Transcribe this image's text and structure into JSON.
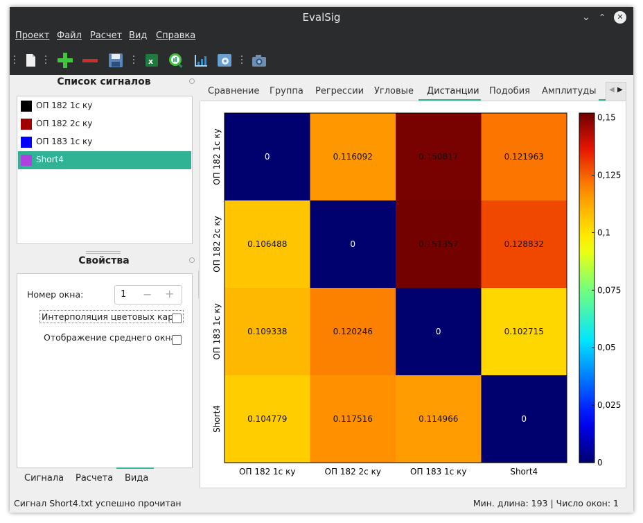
{
  "window": {
    "title": "EvalSig"
  },
  "menu": [
    "Проект",
    "Файл",
    "Расчет",
    "Вид",
    "Справка"
  ],
  "toolbar_icons": [
    "new-document-icon",
    "add-icon",
    "remove-icon",
    "save-icon",
    "excel-icon",
    "chart-search-icon",
    "bar-chart-icon",
    "settings-icon",
    "camera-icon"
  ],
  "signal_panel": {
    "title": "Список сигналов",
    "items": [
      {
        "label": "ОП 182 1с ку",
        "color": "#000000"
      },
      {
        "label": "ОП 182 2с ку",
        "color": "#a00000"
      },
      {
        "label": "ОП 183 1с ку",
        "color": "#0000ff"
      },
      {
        "label": "Short4",
        "color": "#b040e0"
      }
    ],
    "selected": "Short4"
  },
  "properties_panel": {
    "title": "Свойства",
    "window_number_label": "Номер окна:",
    "window_number_value": "1",
    "interp_label": "Интерполяция цветовых карт:",
    "mean_label": "Отображение среднего окна:"
  },
  "bottom_tabs": [
    "Сигнала",
    "Расчета",
    "Вида"
  ],
  "active_bottom_tab": "Вида",
  "tabs": [
    "Сравнение",
    "Группа",
    "Регрессии",
    "Угловые",
    "Дистанции",
    "Подобия",
    "Амплитуды"
  ],
  "active_tab": "Дистанции",
  "status": {
    "left": "Сигнал Short4.txt успешно прочитан",
    "right": "Мин. длина: 193 | Число окон: 1"
  },
  "colors": {
    "accent": "#30b294",
    "titlebar": "#2a2c2d"
  },
  "chart_data": {
    "type": "heatmap",
    "x_categories": [
      "ОП 182 1с ку",
      "ОП 182 2с ку",
      "ОП 183 1с ку",
      "Short4"
    ],
    "y_categories": [
      "ОП 182 1с ку",
      "ОП 182 2с ку",
      "ОП 183 1с ку",
      "Short4"
    ],
    "values": [
      [
        "0",
        "0.116092",
        "0.150817",
        "0.121963"
      ],
      [
        "0.106488",
        "0",
        "0.151357",
        "0.128832"
      ],
      [
        "0.109338",
        "0.120246",
        "0",
        "0.102715"
      ],
      [
        "0.104779",
        "0.117516",
        "0.114966",
        "0"
      ]
    ],
    "colorbar_ticks": [
      "0,15",
      "0,125",
      "0,1",
      "0,075",
      "0,05",
      "0,025",
      "0"
    ],
    "colorbar_range": [
      0,
      0.152
    ],
    "colormap": "jet-like"
  }
}
